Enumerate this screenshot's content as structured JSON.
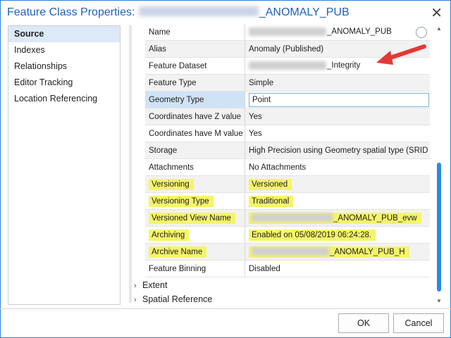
{
  "window": {
    "title_prefix": "Feature Class Properties:",
    "title_suffix": "_ANOMALY_PUB",
    "close_glyph": "✕"
  },
  "sidebar": {
    "items": [
      {
        "label": "Source",
        "active": true
      },
      {
        "label": "Indexes"
      },
      {
        "label": "Relationships"
      },
      {
        "label": "Editor Tracking"
      },
      {
        "label": "Location Referencing"
      }
    ]
  },
  "properties": [
    {
      "name": "Name",
      "value_suffix": "_ANOMALY_PUB"
    },
    {
      "name": "Alias",
      "value": "Anomaly (Published)"
    },
    {
      "name": "Feature Dataset",
      "value_suffix": "_Integrity"
    },
    {
      "name": "Feature Type",
      "value": "Simple"
    },
    {
      "name": "Geometry Type",
      "value": "Point"
    },
    {
      "name": "Coordinates have Z value",
      "value": "Yes"
    },
    {
      "name": "Coordinates have M value",
      "value": "Yes"
    },
    {
      "name": "Storage",
      "value": "High Precision using Geometry spatial type (SRID"
    },
    {
      "name": "Attachments",
      "value": "No Attachments"
    },
    {
      "name": "Versioning",
      "value": "Versioned"
    },
    {
      "name": "Versioning Type",
      "value": "Traditional"
    },
    {
      "name": "Versioned View Name",
      "value_suffix": "_ANOMALY_PUB_evw"
    },
    {
      "name": "Archiving",
      "value": "Enabled on 05/08/2019 06:24:28."
    },
    {
      "name": "Archive Name",
      "value_suffix": "_ANOMALY_PUB_H"
    },
    {
      "name": "Feature Binning",
      "value": "Disabled"
    }
  ],
  "sections": {
    "extent": "Extent",
    "spatial_reference": "Spatial Reference"
  },
  "buttons": {
    "ok": "OK",
    "cancel": "Cancel"
  },
  "colors": {
    "title": "#1c62b9",
    "highlight": "#f5f56a",
    "arrow": "#e53935",
    "accent": "#2a8ae5"
  }
}
